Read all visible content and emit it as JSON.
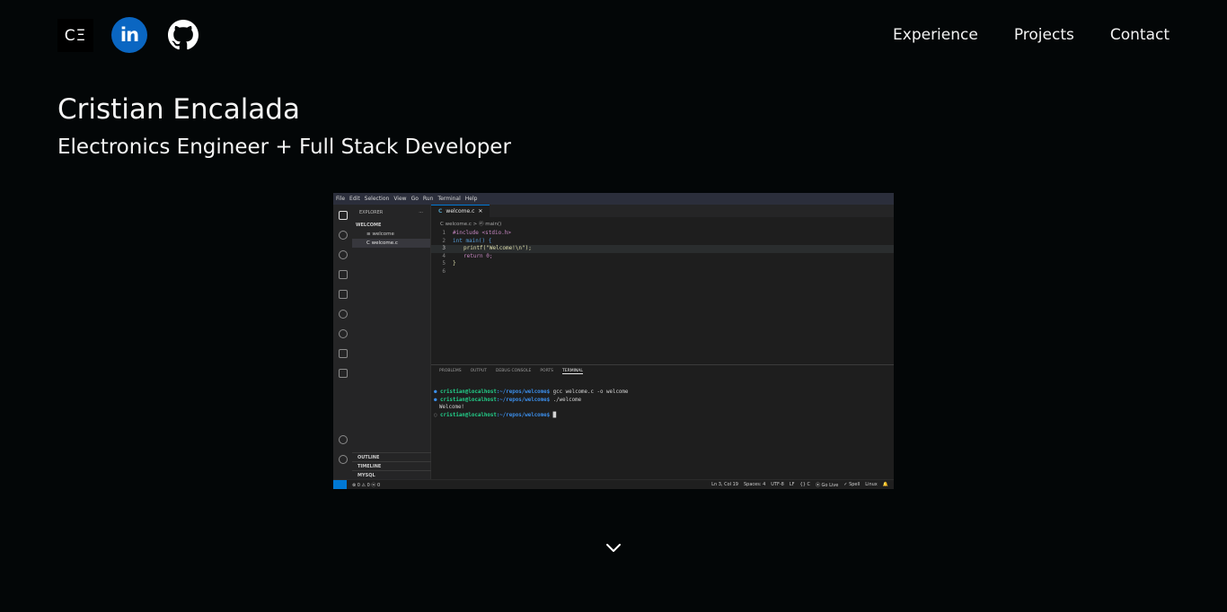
{
  "header": {
    "logo_text": "CΞ",
    "linkedin_text": "in",
    "nav": [
      "Experience",
      "Projects",
      "Contact"
    ]
  },
  "hero": {
    "name": "Cristian Encalada",
    "subtitle": "Electronics Engineer + Full Stack Developer"
  },
  "editor_shot": {
    "menu": [
      "File",
      "Edit",
      "Selection",
      "View",
      "Go",
      "Run",
      "Terminal",
      "Help"
    ],
    "explorer_title": "EXPLORER",
    "explorer_more": "···",
    "folder": "WELCOME",
    "files": [
      "≡ welcome",
      "C welcome.c"
    ],
    "sidebar_sections": [
      "OUTLINE",
      "TIMELINE",
      "MYSQL"
    ],
    "tab_icon": "C",
    "tab_label": "welcome.c",
    "tab_close": "✕",
    "breadcrumb": "C welcome.c > ⓜ main()",
    "code_lines": [
      "#include <stdio.h>",
      "int main() {",
      "printf(\"Welcome!\\n\");",
      "return 0;",
      "}",
      ""
    ],
    "panel_tabs": [
      "PROBLEMS",
      "OUTPUT",
      "DEBUG CONSOLE",
      "PORTS",
      "TERMINAL"
    ],
    "terminal": [
      {
        "prompt": "cristian@localhost",
        "path": ":~/repos/welcome$",
        "cmd": " gcc welcome.c -o welcome"
      },
      {
        "prompt": "cristian@localhost",
        "path": ":~/repos/welcome$",
        "cmd": " ./welcome"
      },
      {
        "prompt": "",
        "path": "",
        "cmd": "Welcome!"
      },
      {
        "prompt": "cristian@localhost",
        "path": ":~/repos/welcome$",
        "cmd": " █"
      }
    ],
    "status_left": "⊗ 0 ⚠ 0   ⓦ 0",
    "status_right": [
      "Ln 3, Col 19",
      "Spaces: 4",
      "UTF-8",
      "LF",
      "{} C",
      "⦿ Go Live",
      "✓ Spell",
      "Linux",
      "🔔"
    ]
  },
  "colors": {
    "background": "#030607",
    "linkedin": "#0a66c2",
    "accent_blue": "#0078d4"
  },
  "icons": [
    "logo-icon",
    "linkedin-icon",
    "github-icon",
    "chevron-down-icon"
  ]
}
